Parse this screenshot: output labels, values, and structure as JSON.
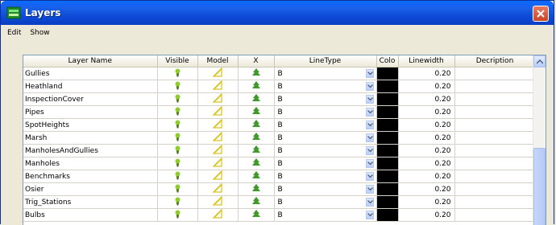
{
  "window": {
    "title": "Layers"
  },
  "menu": [
    "Edit",
    "Show"
  ],
  "table": {
    "columns": [
      "Layer Name",
      "Visible",
      "Model",
      "X",
      "LineType",
      "Colo",
      "Linewidth",
      "Decription"
    ],
    "rows": [
      {
        "name": "Gullies",
        "linetype": "B",
        "linewidth": "0.20"
      },
      {
        "name": "Heathland",
        "linetype": "B",
        "linewidth": "0.20"
      },
      {
        "name": "InspectionCover",
        "linetype": "B",
        "linewidth": "0.20"
      },
      {
        "name": "Pipes",
        "linetype": "B",
        "linewidth": "0.20"
      },
      {
        "name": "SpotHeights",
        "linetype": "B",
        "linewidth": "0.20"
      },
      {
        "name": "Marsh",
        "linetype": "B",
        "linewidth": "0.20"
      },
      {
        "name": "ManholesAndGullies",
        "linetype": "B",
        "linewidth": "0.20"
      },
      {
        "name": "Manholes",
        "linetype": "B",
        "linewidth": "0.20"
      },
      {
        "name": "Benchmarks",
        "linetype": "B",
        "linewidth": "0.20"
      },
      {
        "name": "Osier",
        "linetype": "B",
        "linewidth": "0.20"
      },
      {
        "name": "Trig_Stations",
        "linetype": "B",
        "linewidth": "0.20"
      },
      {
        "name": "Bulbs",
        "linetype": "B",
        "linewidth": "0.20"
      }
    ]
  },
  "icons": {
    "visible": "lightbulb-icon",
    "model": "pencil-ruler-icon",
    "x": "tree-icon",
    "close": "close-icon",
    "app": "layers-icon"
  },
  "colors": {
    "titlebar": "#0c48d4",
    "layer_color": "#000000",
    "close": "#c84427"
  }
}
